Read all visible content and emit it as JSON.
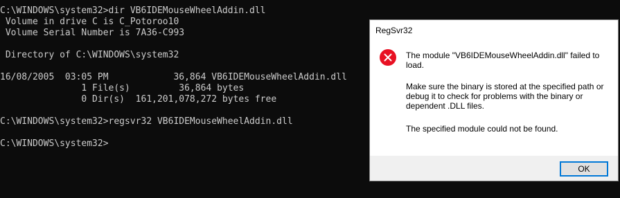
{
  "console": {
    "lines": [
      "C:\\WINDOWS\\system32>dir VB6IDEMouseWheelAddin.dll",
      " Volume in drive C is C_Potoroo10",
      " Volume Serial Number is 7A36-C993",
      "",
      " Directory of C:\\WINDOWS\\system32",
      "",
      "16/08/2005  03:05 PM            36,864 VB6IDEMouseWheelAddin.dll",
      "               1 File(s)         36,864 bytes",
      "               0 Dir(s)  161,201,078,272 bytes free",
      "",
      "C:\\WINDOWS\\system32>regsvr32 VB6IDEMouseWheelAddin.dll",
      "",
      "C:\\WINDOWS\\system32>"
    ]
  },
  "dialog": {
    "title": "RegSvr32",
    "icon": "error-icon",
    "message_line1": "The module \"VB6IDEMouseWheelAddin.dll\" failed to load.",
    "message_line2": "Make sure the binary is stored at the specified path or debug it to check for problems with the binary or dependent .DLL files.",
    "message_line3": "The specified module could not be found.",
    "ok_label": "OK"
  },
  "colors": {
    "console_background": "#0c0c0c",
    "console_text": "#cccccc",
    "error_red": "#e81123",
    "button_focus": "#0078d7"
  }
}
